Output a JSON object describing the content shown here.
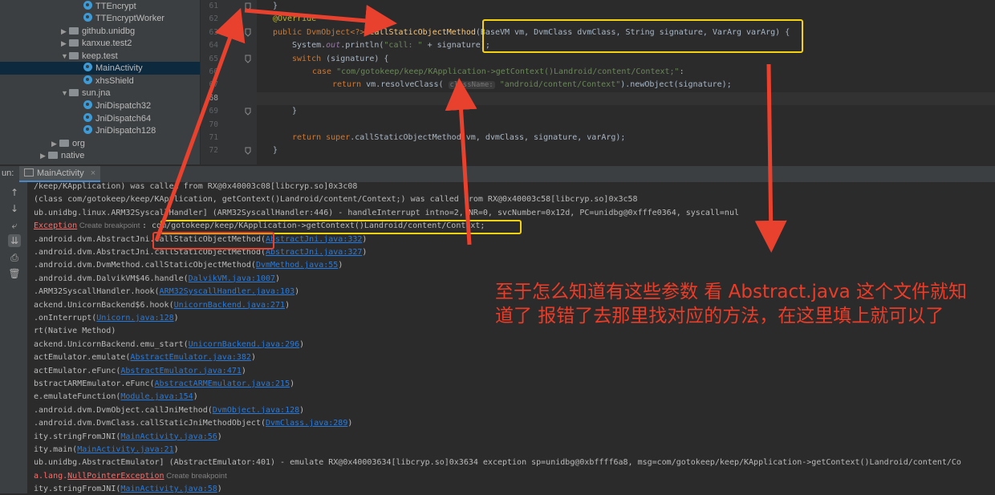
{
  "tree": {
    "items": [
      {
        "label": "TTEncrypt",
        "kind": "class"
      },
      {
        "label": "TTEncryptWorker",
        "kind": "class"
      },
      {
        "label": "github.unidbg",
        "kind": "package"
      },
      {
        "label": "kanxue.test2",
        "kind": "package"
      },
      {
        "label": "keep.test",
        "kind": "package"
      },
      {
        "label": "MainActivity",
        "kind": "class"
      },
      {
        "label": "xhsShield",
        "kind": "class"
      },
      {
        "label": "sun.jna",
        "kind": "package"
      },
      {
        "label": "JniDispatch32",
        "kind": "class"
      },
      {
        "label": "JniDispatch64",
        "kind": "class"
      },
      {
        "label": "JniDispatch128",
        "kind": "class"
      },
      {
        "label": "org",
        "kind": "package"
      },
      {
        "label": "native",
        "kind": "package"
      }
    ]
  },
  "editor": {
    "line_numbers": [
      "61",
      "62",
      "63",
      "64",
      "65",
      "66",
      "67",
      "68",
      "69",
      "70",
      "71",
      "72"
    ],
    "code": {
      "l61": "}",
      "l62": "@Override",
      "l63a": "public DvmObject<?> ",
      "l63b": "callStaticObjectMethod",
      "l63c": "(BaseVM vm, DvmClass dvmClass, String signature, VarArg varArg) {",
      "l64a": "System.",
      "l64b": "out",
      "l64c": ".println(",
      "l64d": "\"call: \"",
      "l64e": " + signature);",
      "l65a": "switch",
      "l65b": " (signature) {",
      "l66a": "case ",
      "l66b": "\"com/gotokeep/keep/KApplication->getContext()Landroid/content/Context;\"",
      "l66c": ":",
      "l67a": "return ",
      "l67b": "vm.resolveClass( ",
      "l67hint": "className:",
      "l67c": " \"android/content/Context\"",
      "l67d": ").newObject(signature);",
      "l69": "}",
      "l71a": "return super",
      "l71b": ".callStaticObjectMethod(vm, dvmClass, signature, varArg);",
      "l72": "}"
    }
  },
  "run": {
    "label": "un:",
    "tab": "MainActivity",
    "close": "×"
  },
  "console": {
    "lines": [
      {
        "segs": [
          {
            "t": "/keep/KApplication) was called from RX@0x40003c08[libcryp.so]0x3c08"
          }
        ]
      },
      {
        "segs": [
          {
            "t": "(class com/gotokeep/keep/KApplication, getContext()Landroid/content/Context;) was called from RX@0x40003c58[libcryp.so]0x3c58"
          }
        ]
      },
      {
        "segs": [
          {
            "t": "ub.unidbg.linux.ARM32SyscallHandler] (ARM32SyscallHandler:446) - handleInterrupt intno=2, NR=0, svcNumber=0x12d, PC=unidbg@0xfffe0364, syscall=nul"
          }
        ]
      },
      {
        "segs": [
          {
            "t": "Exception",
            "c": "link-err"
          },
          {
            "t": " Create breakpoint ",
            "c": "bp"
          },
          {
            "t": ": com/gotokeep/keep/KApplication->getContext()Landroid/content/Context;"
          }
        ]
      },
      {
        "segs": [
          {
            "t": ".android.dvm.AbstractJni.callStaticObjectMethod("
          },
          {
            "t": "AbstractJni.java:332",
            "c": "link"
          },
          {
            "t": ")"
          }
        ]
      },
      {
        "segs": [
          {
            "t": ".android.dvm.AbstractJni.callStaticObjectMethod("
          },
          {
            "t": "AbstractJni.java:327",
            "c": "link"
          },
          {
            "t": ")"
          }
        ]
      },
      {
        "segs": [
          {
            "t": ".android.dvm.DvmMethod.callStaticObjectMethod("
          },
          {
            "t": "DvmMethod.java:55",
            "c": "link"
          },
          {
            "t": ")"
          }
        ]
      },
      {
        "segs": [
          {
            "t": ".android.dvm.DalvikVM$46.handle("
          },
          {
            "t": "DalvikVM.java:1007",
            "c": "link"
          },
          {
            "t": ")"
          }
        ]
      },
      {
        "segs": [
          {
            "t": ".ARM32SyscallHandler.hook("
          },
          {
            "t": "ARM32SyscallHandler.java:103",
            "c": "link"
          },
          {
            "t": ")"
          }
        ]
      },
      {
        "segs": [
          {
            "t": "ackend.UnicornBackend$6.hook("
          },
          {
            "t": "UnicornBackend.java:271",
            "c": "link"
          },
          {
            "t": ")"
          }
        ]
      },
      {
        "segs": [
          {
            "t": ".onInterrupt("
          },
          {
            "t": "Unicorn.java:128",
            "c": "link"
          },
          {
            "t": ")"
          }
        ]
      },
      {
        "segs": [
          {
            "t": "rt(Native Method)"
          }
        ]
      },
      {
        "segs": [
          {
            "t": "ackend.UnicornBackend.emu_start("
          },
          {
            "t": "UnicornBackend.java:296",
            "c": "link"
          },
          {
            "t": ")"
          }
        ]
      },
      {
        "segs": [
          {
            "t": "actEmulator.emulate("
          },
          {
            "t": "AbstractEmulator.java:382",
            "c": "link"
          },
          {
            "t": ")"
          }
        ]
      },
      {
        "segs": [
          {
            "t": "actEmulator.eFunc("
          },
          {
            "t": "AbstractEmulator.java:471",
            "c": "link"
          },
          {
            "t": ")"
          }
        ]
      },
      {
        "segs": [
          {
            "t": "bstractARMEmulator.eFunc("
          },
          {
            "t": "AbstractARMEmulator.java:215",
            "c": "link"
          },
          {
            "t": ")"
          }
        ]
      },
      {
        "segs": [
          {
            "t": "e.emulateFunction("
          },
          {
            "t": "Module.java:154",
            "c": "link"
          },
          {
            "t": ")"
          }
        ]
      },
      {
        "segs": [
          {
            "t": ".android.dvm.DvmObject.callJniMethod("
          },
          {
            "t": "DvmObject.java:128",
            "c": "link"
          },
          {
            "t": ")"
          }
        ]
      },
      {
        "segs": [
          {
            "t": ".android.dvm.DvmClass.callStaticJniMethodObject("
          },
          {
            "t": "DvmClass.java:289",
            "c": "link"
          },
          {
            "t": ")"
          }
        ]
      },
      {
        "segs": [
          {
            "t": "ity.stringFromJNI("
          },
          {
            "t": "MainActivity.java:56",
            "c": "link"
          },
          {
            "t": ")"
          }
        ]
      },
      {
        "segs": [
          {
            "t": "ity.main("
          },
          {
            "t": "MainActivity.java:21",
            "c": "link"
          },
          {
            "t": ")"
          }
        ]
      },
      {
        "segs": [
          {
            "t": "ub.unidbg.AbstractEmulator] (AbstractEmulator:401) - emulate RX@0x40003634[libcryp.so]0x3634 exception sp=unidbg@0xbffff6a8, msg=com/gotokeep/keep/KApplication->getContext()Landroid/content/Co"
          }
        ]
      },
      {
        "segs": [
          {
            "t": "a.lang.",
            "c": "err"
          },
          {
            "t": "NullPointerException",
            "c": "link-err"
          },
          {
            "t": " Create breakpoint",
            "c": "bp"
          }
        ]
      },
      {
        "segs": [
          {
            "t": "ity.stringFromJNI("
          },
          {
            "t": "MainActivity.java:58",
            "c": "link"
          },
          {
            "t": ")"
          }
        ]
      }
    ]
  },
  "annotation": {
    "text": "至于怎么知道有这些参数  看 Abstract.java 这个文件就知道了  报错了去那里找对应的方法，在这里填上就可以了"
  },
  "colors": {
    "annotation_red": "#e8412e",
    "highlight_yellow": "#f5d312",
    "link_blue": "#287bde"
  }
}
